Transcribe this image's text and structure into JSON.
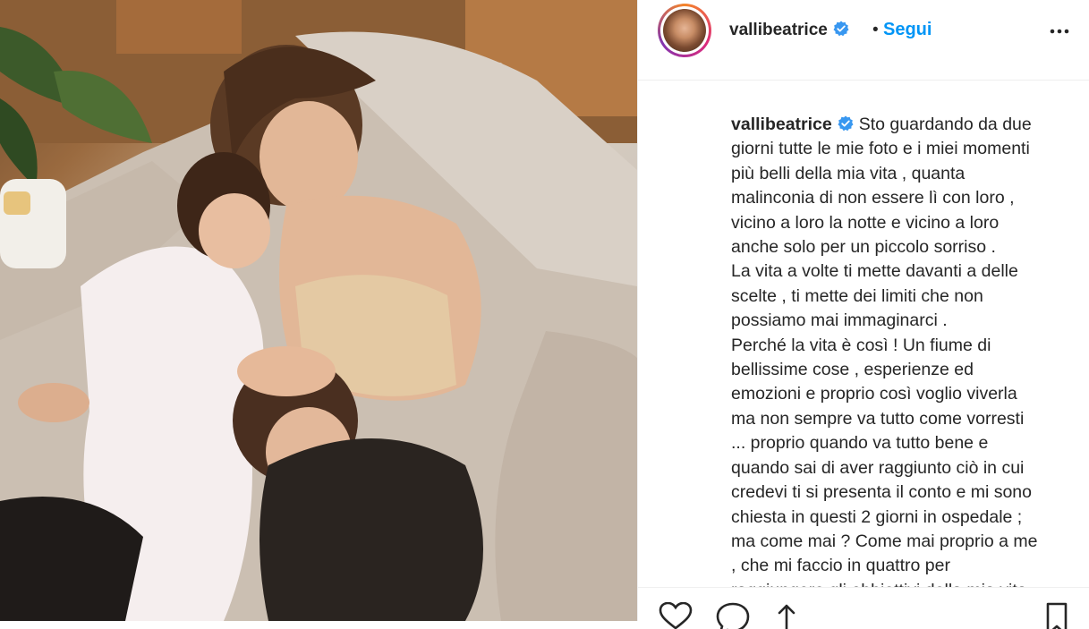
{
  "post": {
    "username": "vallibeatrice",
    "separator": "•",
    "follow_label": "Segui",
    "caption_lines": [
      "Sto guardando da due",
      "giorni tutte le mie foto e i miei momenti",
      "più belli della mia vita , quanta",
      "malinconia di non essere lì con loro ,",
      "vicino a loro la notte e vicino a loro",
      "anche solo per un piccolo sorriso .",
      "La vita a volte ti mette davanti a delle",
      "scelte , ti mette dei limiti che non",
      "possiamo mai immaginarci .",
      "Perché la vita è così ! Un fiume di",
      "bellissime cose , esperienze ed",
      "emozioni e proprio così voglio viverla",
      "ma non sempre va tutto come vorresti",
      "... proprio quando va tutto bene e",
      "quando sai di aver raggiunto ciò in cui",
      "credevi ti si presenta il conto e mi sono",
      "chiesta in questi 2 giorni in ospedale ;",
      "ma come mai ? Come mai proprio a me",
      ", che mi faccio in quattro per",
      "raggiungere gli obbiettivi della mia vita"
    ]
  },
  "icons": {
    "verified": "verified-badge-icon",
    "more": "more-options-icon",
    "like": "heart-icon",
    "comment": "comment-icon",
    "share": "share-icon",
    "save": "bookmark-icon"
  },
  "colors": {
    "follow": "#0095f6",
    "verified": "#3897f0",
    "text": "#262626"
  }
}
